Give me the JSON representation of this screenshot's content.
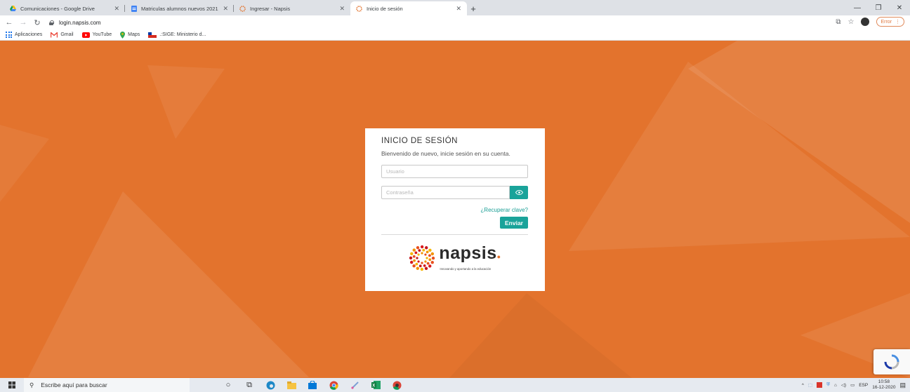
{
  "browser": {
    "tabs": [
      {
        "title": "Comunicaciones - Google Drive",
        "icon": "google-drive-icon",
        "active": false
      },
      {
        "title": "Matriculas alumnos nuevos 2021",
        "icon": "google-sheets-icon",
        "active": false
      },
      {
        "title": "Ingresar - Napsis",
        "icon": "napsis-icon",
        "active": false
      },
      {
        "title": "Inicio de sesión",
        "icon": "napsis-icon",
        "active": true
      }
    ],
    "new_tab": "+",
    "url": "login.napsis.com",
    "error_label": "Error"
  },
  "bookmarks": [
    {
      "label": "Aplicaciones",
      "icon": "apps-grid-icon"
    },
    {
      "label": "Gmail",
      "icon": "gmail-icon"
    },
    {
      "label": "YouTube",
      "icon": "youtube-icon"
    },
    {
      "label": "Maps",
      "icon": "maps-icon"
    },
    {
      "label": ".:SIGE: Ministerio d...",
      "icon": "chile-flag-icon"
    }
  ],
  "login": {
    "title": "INICIO DE SESIÓN",
    "subtitle": "Bienvenido de nuevo, inicie sesión en su cuenta.",
    "username_placeholder": "Usuario",
    "password_placeholder": "Contraseña",
    "recover_link": "¿Recuperar clave?",
    "submit_label": "Enviar"
  },
  "logo": {
    "word": "napsis",
    "tagline": "Innovando y aportando a la educación"
  },
  "colors": {
    "page_bg": "#e3732d",
    "accent": "#1aa39a"
  },
  "taskbar": {
    "search_placeholder": "Escribe aquí para buscar",
    "language": "ESP",
    "time": "10:58",
    "date": "16-12-2020"
  }
}
